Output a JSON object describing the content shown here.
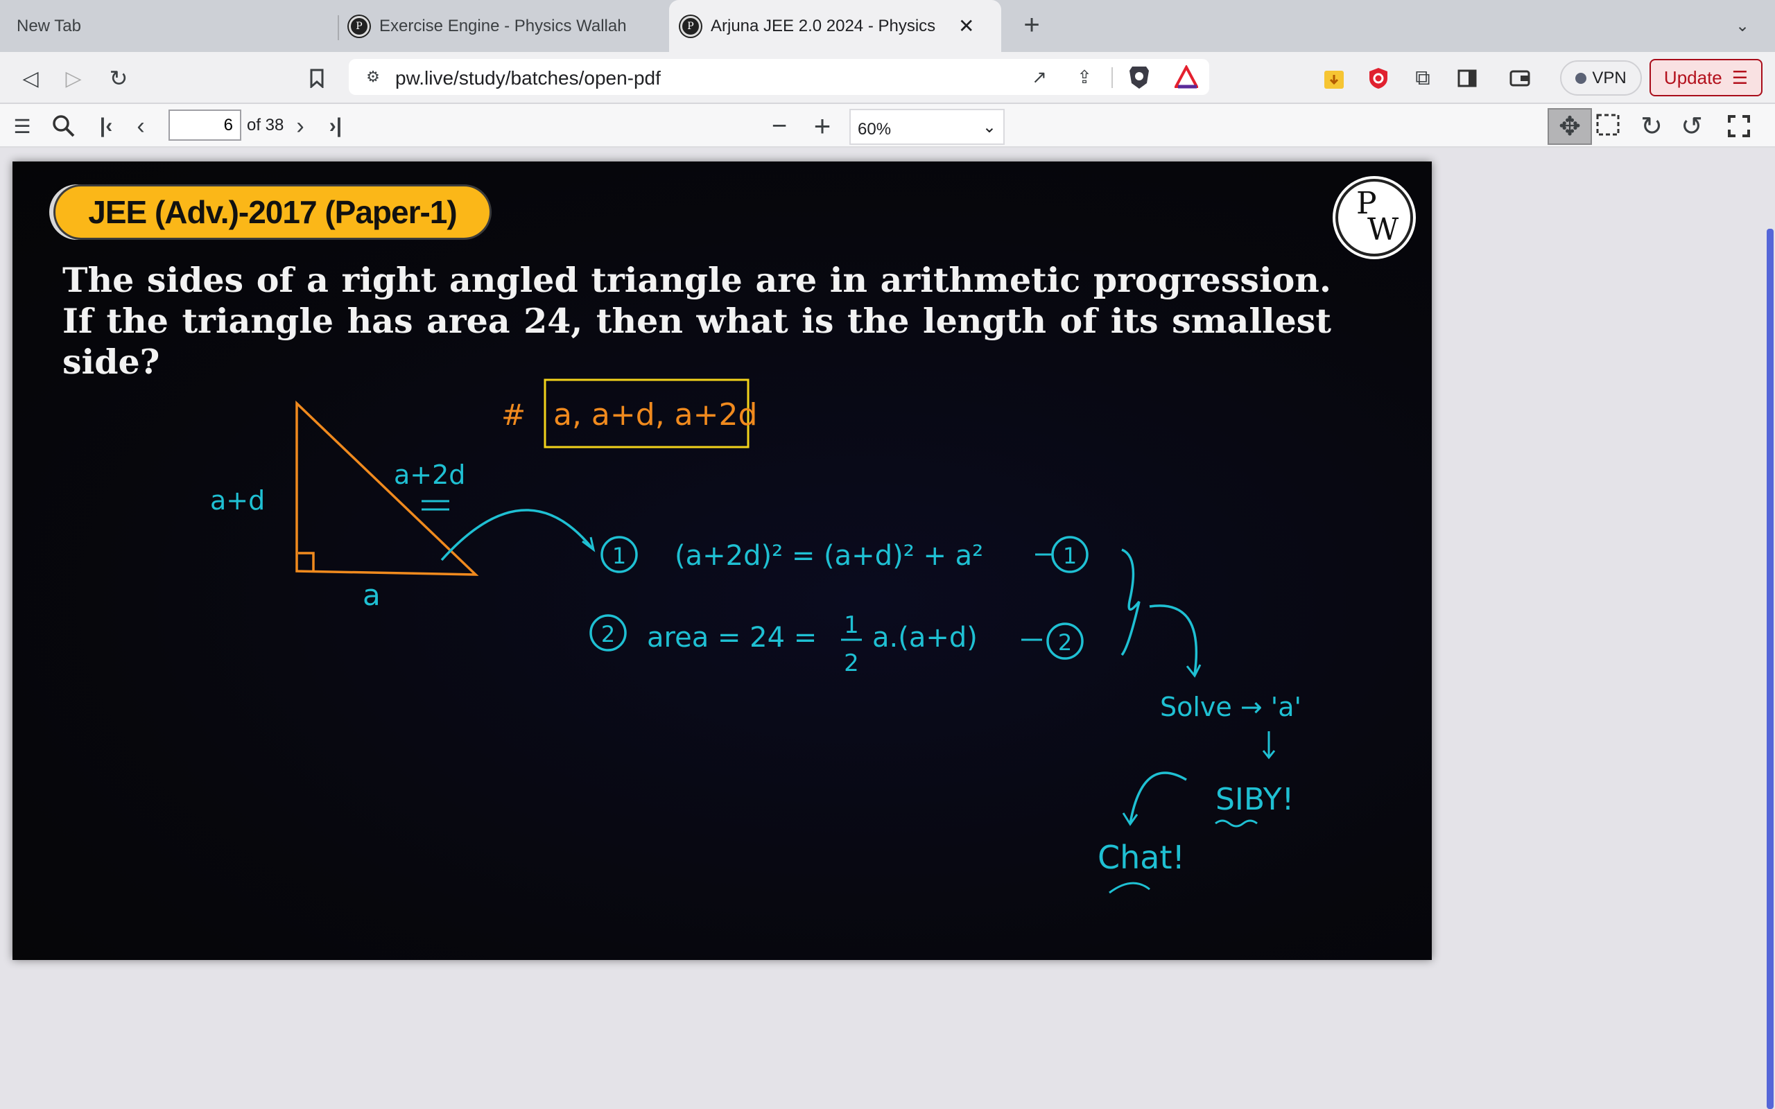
{
  "browser": {
    "tabs": [
      {
        "title": "New Tab",
        "active": false
      },
      {
        "title": "Exercise Engine - Physics Wallah",
        "active": false
      },
      {
        "title": "Arjuna JEE 2.0 2024 - Physics",
        "active": true
      }
    ],
    "url": "pw.live/study/batches/open-pdf",
    "vpn_label": "VPN",
    "update_label": "Update"
  },
  "pdf_toolbar": {
    "page": "6",
    "page_total": "of 38",
    "zoom": "60%"
  },
  "slide": {
    "badge": "JEE (Adv.)-2017 (Paper-1)",
    "logo": "PW",
    "question": "The sides of a right angled triangle are in arithmetic progression. If the triangle has area 24, then what is the length of its smallest side?",
    "annotations": {
      "side_vertical": "a+d",
      "side_hyp": "a+2d",
      "side_base": "a",
      "hash": "#",
      "ap_box": "a, a+d, a+2d",
      "eq1_num": "1",
      "eq1": "(a+2d)² = (a+d)² + a²",
      "eq1_tag": "1",
      "eq2_num": "2",
      "eq2_lhs": "area = 24 =",
      "eq2_frac_num": "1",
      "eq2_frac_den": "2",
      "eq2_rhs": "a.(a+d)",
      "eq2_tag": "2",
      "solve": "Solve → 'a'",
      "siby": "SIBY!",
      "chat": "Chat!"
    },
    "colors": {
      "cyan": "#1fc0d3",
      "orange": "#f08a1e",
      "badge": "#fbb718",
      "box": "#f2d21b"
    }
  }
}
